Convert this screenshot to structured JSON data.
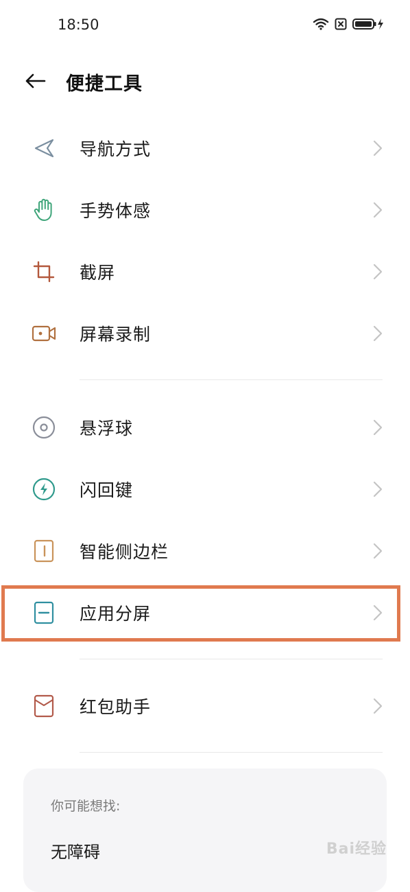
{
  "status": {
    "time": "18:50"
  },
  "header": {
    "title": "便捷工具"
  },
  "group1": [
    {
      "label": "导航方式",
      "icon": "navigation-arrow-icon"
    },
    {
      "label": "手势体感",
      "icon": "hand-gesture-icon"
    },
    {
      "label": "截屏",
      "icon": "crop-screenshot-icon"
    },
    {
      "label": "屏幕录制",
      "icon": "screen-record-icon"
    }
  ],
  "group2": [
    {
      "label": "悬浮球",
      "icon": "floating-ball-icon"
    },
    {
      "label": "闪回键",
      "icon": "flashback-lightning-icon"
    },
    {
      "label": "智能侧边栏",
      "icon": "smart-sidebar-icon"
    },
    {
      "label": "应用分屏",
      "icon": "split-screen-icon"
    }
  ],
  "group3": [
    {
      "label": "红包助手",
      "icon": "red-envelope-icon"
    }
  ],
  "suggest": {
    "title": "你可能想找:",
    "items": [
      "无障碍"
    ]
  },
  "watermark": "Bai经验",
  "colors": {
    "highlight": "#e07a4f",
    "card_bg": "#f5f5f7"
  }
}
